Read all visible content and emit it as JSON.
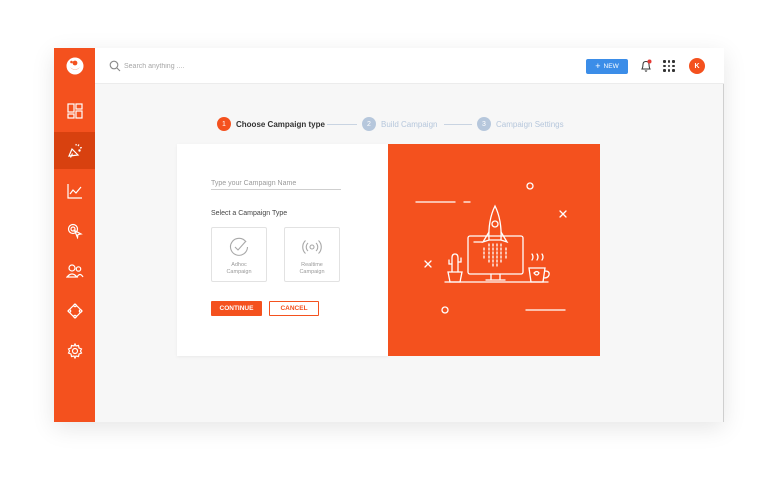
{
  "topbar": {
    "search_placeholder": "Search anything ....",
    "new_button_label": "NEW",
    "avatar_initial": "K"
  },
  "sidebar": {
    "items": [
      {
        "icon": "dashboard-icon",
        "active": false
      },
      {
        "icon": "campaign-megaphone-icon",
        "active": true
      },
      {
        "icon": "analytics-chart-icon",
        "active": false
      },
      {
        "icon": "target-click-icon",
        "active": false
      },
      {
        "icon": "users-icon",
        "active": false
      },
      {
        "icon": "integrations-icon",
        "active": false
      },
      {
        "icon": "settings-gear-icon",
        "active": false
      }
    ]
  },
  "stepper": {
    "steps": [
      {
        "number": "1",
        "label": "Choose Campaign type",
        "state": "active"
      },
      {
        "number": "2",
        "label": "Build Campaign",
        "state": "inactive"
      },
      {
        "number": "3",
        "label": "Campaign Settings",
        "state": "inactive"
      }
    ]
  },
  "form": {
    "name_placeholder": "Type your Campaign Name",
    "select_label": "Select a Campaign Type",
    "types": [
      {
        "label_line1": "Adhoc",
        "label_line2": "Campaign",
        "icon": "adhoc-check-icon"
      },
      {
        "label_line1": "Realtime",
        "label_line2": "Campaign",
        "icon": "realtime-broadcast-icon"
      }
    ],
    "continue_label": "CONTINUE",
    "cancel_label": "CANCEL"
  },
  "colors": {
    "brand": "#f4511e",
    "accent_blue": "#3b8de8",
    "step_inactive": "#b6c7dc"
  }
}
